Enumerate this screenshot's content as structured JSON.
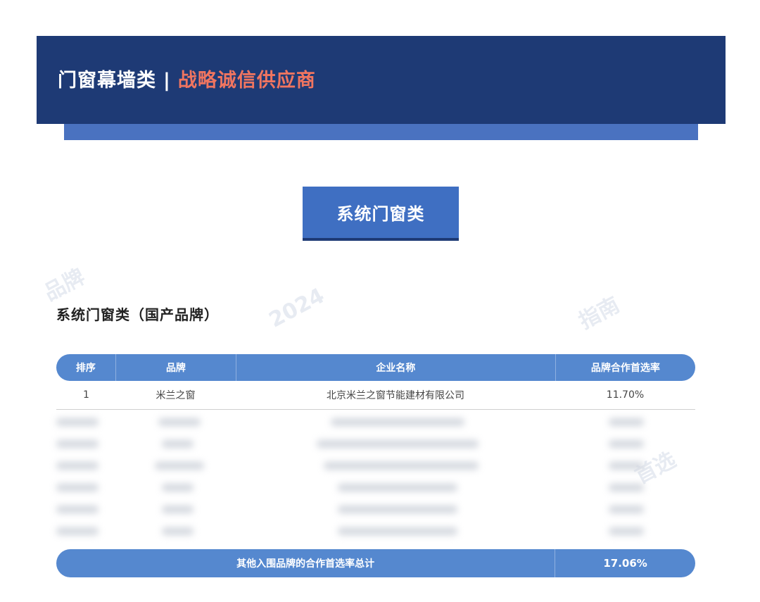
{
  "header": {
    "category": "门窗幕墙类",
    "separator": "|",
    "subtitle": "战略诚信供应商"
  },
  "section_button": "系统门窗类",
  "section_title": "系统门窗类（国产品牌）",
  "table": {
    "headers": [
      "排序",
      "品牌",
      "企业名称",
      "品牌合作首选率"
    ],
    "rows": [
      [
        "1",
        "米兰之窗",
        "北京米兰之窗节能建材有限公司",
        "11.70%"
      ]
    ]
  },
  "footer": {
    "label": "其他入围品牌的合作首选率总计",
    "value": "17.06%"
  },
  "colors": {
    "header_bg": "#1e3a75",
    "header_accent": "#f07560",
    "table_blue": "#5588cf",
    "button_blue": "#3f6fc2"
  }
}
